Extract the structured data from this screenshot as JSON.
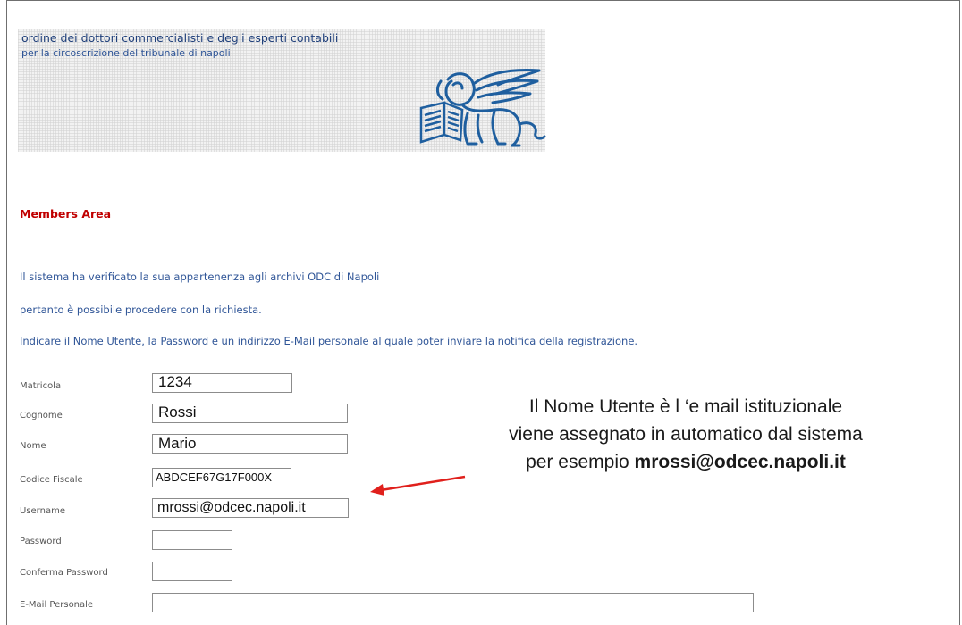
{
  "header": {
    "org_title": "ordine dei dottori commercialisti e degli esperti contabili",
    "org_subtitle": "per la circoscrizione del tribunale di napoli",
    "logo_icon": "winged-lion-logo"
  },
  "section_title": "Members Area",
  "messages": [
    "Il sistema ha verificato la sua appartenenza agli archivi ODC di Napoli",
    "pertanto è possibile procedere con la richiesta.",
    "Indicare il Nome Utente, la Password e un indirizzo E-Mail personale al quale poter inviare la notifica della registrazione."
  ],
  "form": {
    "matricola": {
      "label": "Matricola",
      "value": "1234"
    },
    "cognome": {
      "label": "Cognome",
      "value": "Rossi"
    },
    "nome": {
      "label": "Nome",
      "value": "Mario"
    },
    "codice_fiscale": {
      "label": "Codice Fiscale",
      "value": "ABDCEF67G17F000X"
    },
    "username": {
      "label": "Username",
      "value": "mrossi@odcec.napoli.it"
    },
    "password": {
      "label": "Password",
      "value": ""
    },
    "conferma_password": {
      "label": "Conferma Password",
      "value": ""
    },
    "email_personale": {
      "label": "E-Mail Personale",
      "value": ""
    }
  },
  "annotation": {
    "line1": "Il Nome Utente è l ‘e mail istituzionale",
    "line2": "viene assegnato in automatico dal sistema",
    "line3_prefix": "per esempio ",
    "line3_bold": "mrossi@odcec.napoli.it",
    "arrow_color": "#e0201c"
  },
  "colors": {
    "title_blue": "#1f3f7a",
    "info_blue": "#2f5597",
    "section_red": "#c00000"
  }
}
